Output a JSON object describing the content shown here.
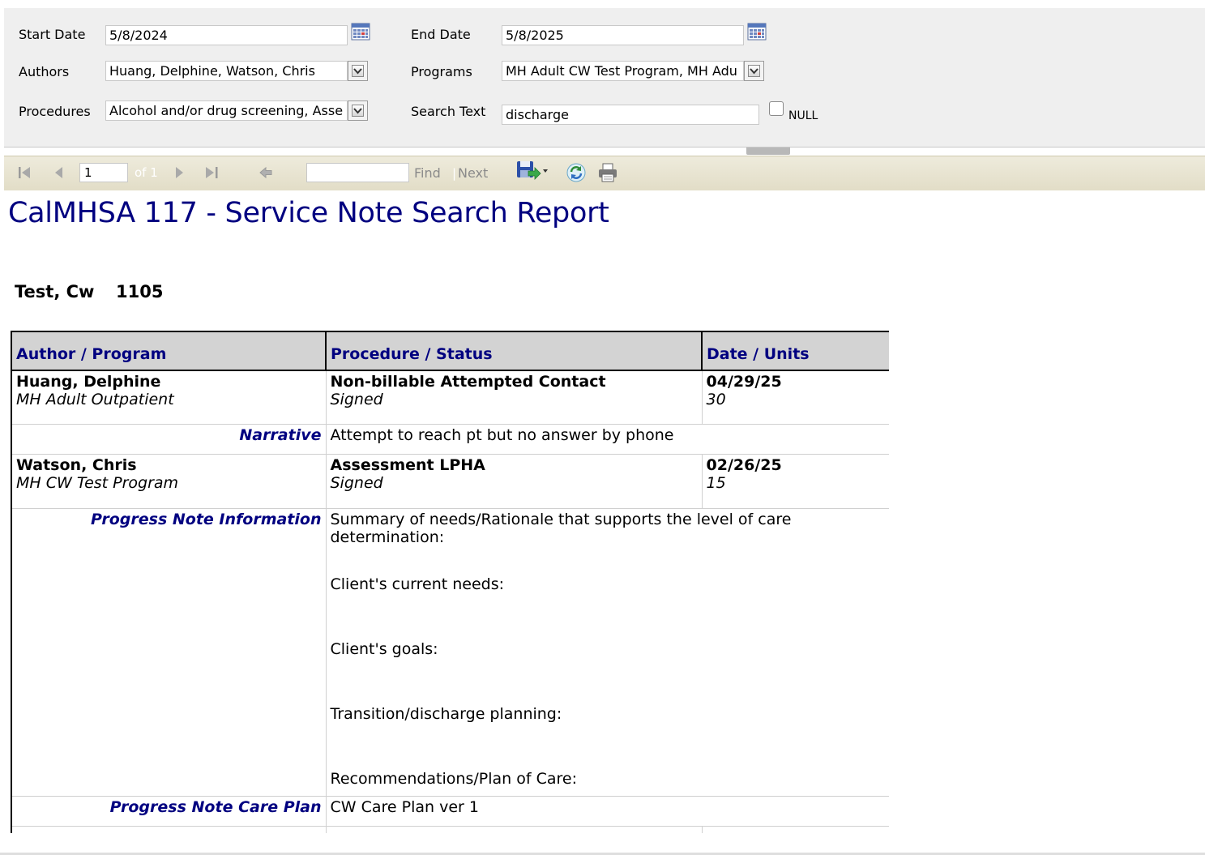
{
  "params": {
    "start_date_label": "Start Date",
    "start_date_value": "5/8/2024",
    "end_date_label": "End Date",
    "end_date_value": "5/8/2025",
    "authors_label": "Authors",
    "authors_value": "Huang, Delphine, Watson, Chris",
    "programs_label": "Programs",
    "programs_value": "MH Adult CW Test Program, MH Adu",
    "procedures_label": "Procedures",
    "procedures_value": "Alcohol and/or drug screening, Asse",
    "search_text_label": "Search Text",
    "search_text_value": "discharge",
    "null_label": "NULL"
  },
  "toolbar": {
    "page_number": "1",
    "page_of": "of 1",
    "find_label": "Find",
    "separator": "|",
    "next_label": "Next"
  },
  "report": {
    "title": "CalMHSA 117 - Service Note Search Report",
    "client_name": "Test, Cw",
    "client_id": "1105",
    "columns": [
      "Author / Program",
      "Procedure / Status",
      "Date / Units"
    ],
    "notes": [
      {
        "author": "Huang, Delphine",
        "program": "MH Adult Outpatient",
        "procedure": "Non-billable Attempted Contact",
        "status": "Signed",
        "date": "04/29/25",
        "units": "30",
        "detail_label": "Narrative",
        "detail_text": "Attempt to reach pt but no answer by phone"
      },
      {
        "author": "Watson, Chris",
        "program": "MH CW Test Program",
        "procedure": "Assessment LPHA",
        "status": "Signed",
        "date": "02/26/25",
        "units": "15",
        "detail_label": "Progress Note Information",
        "detail_lines": [
          "Summary of needs/Rationale that supports the level of care determination:",
          "Client's current needs:",
          "Client's goals:",
          "Transition/discharge planning:",
          "Recommendations/Plan of Care:"
        ],
        "care_plan_label": "Progress Note Care Plan",
        "care_plan_text": "CW Care Plan ver 1"
      }
    ]
  }
}
